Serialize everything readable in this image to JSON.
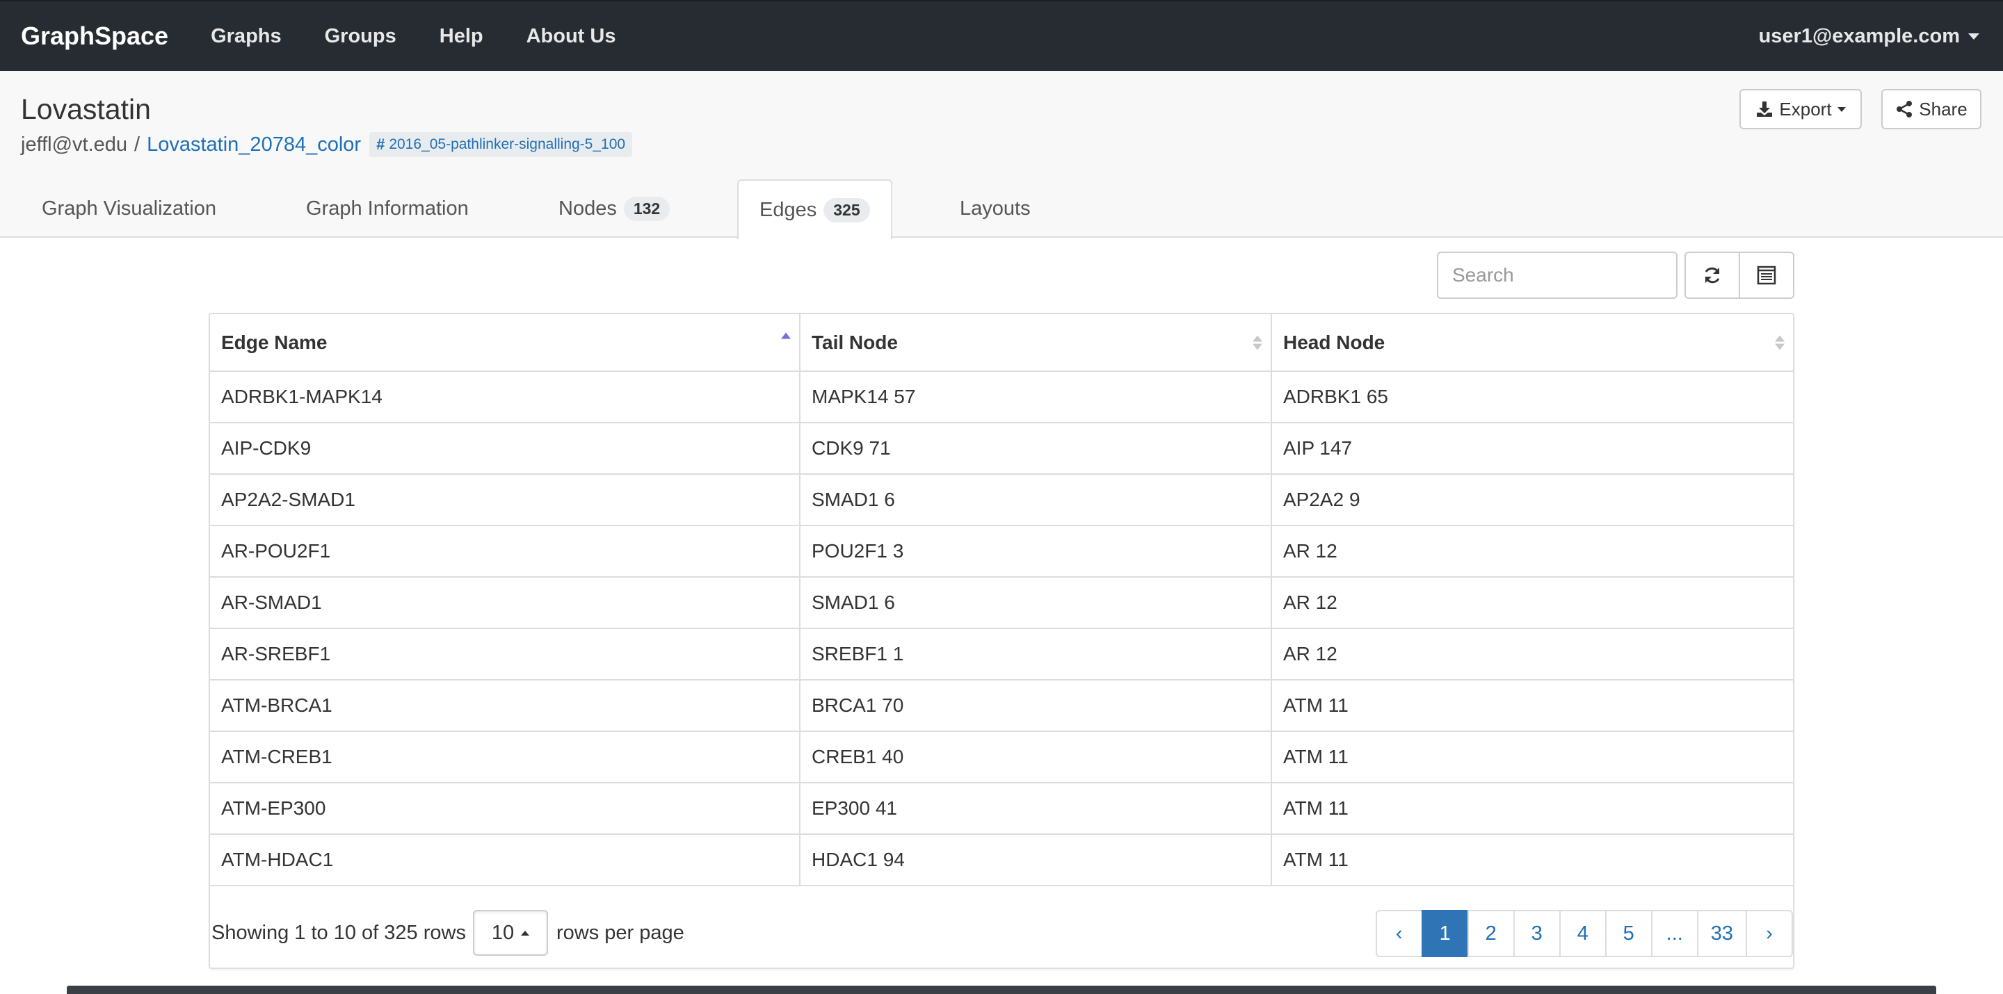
{
  "navbar": {
    "brand": "GraphSpace",
    "links": [
      "Graphs",
      "Groups",
      "Help",
      "About Us"
    ],
    "user": "user1@example.com"
  },
  "header": {
    "title": "Lovastatin",
    "owner": "jeffl@vt.edu",
    "separator": "/",
    "graph_name": "Lovastatin_20784_color",
    "tag": "2016_05-pathlinker-signalling-5_100",
    "export_label": "Export",
    "share_label": "Share"
  },
  "tabs": [
    {
      "label": "Graph Visualization",
      "badge": ""
    },
    {
      "label": "Graph Information",
      "badge": ""
    },
    {
      "label": "Nodes",
      "badge": "132"
    },
    {
      "label": "Edges",
      "badge": "325"
    },
    {
      "label": "Layouts",
      "badge": ""
    }
  ],
  "active_tab": "Edges",
  "toolbar": {
    "search_placeholder": "Search"
  },
  "table": {
    "columns": [
      "Edge Name",
      "Tail Node",
      "Head Node"
    ],
    "sorted_column": "Edge Name",
    "rows": [
      [
        "ADRBK1-MAPK14",
        "MAPK14 57",
        "ADRBK1 65"
      ],
      [
        "AIP-CDK9",
        "CDK9 71",
        "AIP 147"
      ],
      [
        "AP2A2-SMAD1",
        "SMAD1 6",
        "AP2A2 9"
      ],
      [
        "AR-POU2F1",
        "POU2F1 3",
        "AR 12"
      ],
      [
        "AR-SMAD1",
        "SMAD1 6",
        "AR 12"
      ],
      [
        "AR-SREBF1",
        "SREBF1 1",
        "AR 12"
      ],
      [
        "ATM-BRCA1",
        "BRCA1 70",
        "ATM 11"
      ],
      [
        "ATM-CREB1",
        "CREB1 40",
        "ATM 11"
      ],
      [
        "ATM-EP300",
        "EP300 41",
        "ATM 11"
      ],
      [
        "ATM-HDAC1",
        "HDAC1 94",
        "ATM 11"
      ]
    ]
  },
  "footer": {
    "showing": "Showing 1 to 10 of 325 rows",
    "page_size": "10",
    "rows_per_page": "rows per page",
    "pages": [
      "‹",
      "1",
      "2",
      "3",
      "4",
      "5",
      "...",
      "33",
      "›"
    ],
    "active_page": "1"
  },
  "colors": {
    "navbar_bg": "#262c32",
    "link": "#1f6fb5",
    "active_page": "#2f74b5",
    "sort_active": "#6f74d9"
  }
}
